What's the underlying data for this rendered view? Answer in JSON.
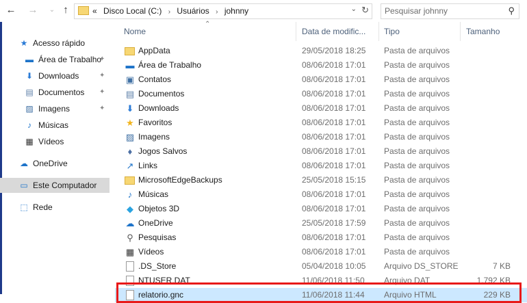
{
  "address": {
    "crumbs": [
      "«",
      "Disco Local (C:)",
      "›",
      "Usuários",
      "›",
      "johnny"
    ],
    "dropdown_icon": "chevron-down-icon",
    "refresh_icon": "refresh-icon"
  },
  "search": {
    "placeholder": "Pesquisar johnny"
  },
  "nav": {
    "items": [
      {
        "label": "Acesso rápido",
        "icon": "star",
        "color": "#2b7bd6",
        "pinned": false
      },
      {
        "label": "Área de Trabalho",
        "icon": "desktop",
        "color": "#1d73c9",
        "pinned": true
      },
      {
        "label": "Downloads",
        "icon": "download",
        "color": "#2b7bd6",
        "pinned": true
      },
      {
        "label": "Documentos",
        "icon": "doc",
        "color": "#5d7fa8",
        "pinned": true
      },
      {
        "label": "Imagens",
        "icon": "pic",
        "color": "#3f6fa3",
        "pinned": true
      },
      {
        "label": "Músicas",
        "icon": "music",
        "color": "#1d73c9",
        "pinned": false
      },
      {
        "label": "Vídeos",
        "icon": "video",
        "color": "#333333",
        "pinned": false
      },
      {
        "label": "OneDrive",
        "icon": "cloud",
        "color": "#1d73c9",
        "pinned": false
      },
      {
        "label": "Este Computador",
        "icon": "pc",
        "color": "#1d73c9",
        "pinned": false,
        "selected": true
      },
      {
        "label": "Rede",
        "icon": "net",
        "color": "#1d73c9",
        "pinned": false
      }
    ]
  },
  "columns": {
    "name": "Nome",
    "date": "Data de modific...",
    "type": "Tipo",
    "size": "Tamanho"
  },
  "files": [
    {
      "name": "AppData",
      "date": "29/05/2018 18:25",
      "type": "Pasta de arquivos",
      "size": "",
      "icon": "folder"
    },
    {
      "name": "Área de Trabalho",
      "date": "08/06/2018 17:01",
      "type": "Pasta de arquivos",
      "size": "",
      "icon": "desktop"
    },
    {
      "name": "Contatos",
      "date": "08/06/2018 17:01",
      "type": "Pasta de arquivos",
      "size": "",
      "icon": "contacts"
    },
    {
      "name": "Documentos",
      "date": "08/06/2018 17:01",
      "type": "Pasta de arquivos",
      "size": "",
      "icon": "doc"
    },
    {
      "name": "Downloads",
      "date": "08/06/2018 17:01",
      "type": "Pasta de arquivos",
      "size": "",
      "icon": "download"
    },
    {
      "name": "Favoritos",
      "date": "08/06/2018 17:01",
      "type": "Pasta de arquivos",
      "size": "",
      "icon": "star"
    },
    {
      "name": "Imagens",
      "date": "08/06/2018 17:01",
      "type": "Pasta de arquivos",
      "size": "",
      "icon": "pic"
    },
    {
      "name": "Jogos Salvos",
      "date": "08/06/2018 17:01",
      "type": "Pasta de arquivos",
      "size": "",
      "icon": "games"
    },
    {
      "name": "Links",
      "date": "08/06/2018 17:01",
      "type": "Pasta de arquivos",
      "size": "",
      "icon": "link"
    },
    {
      "name": "MicrosoftEdgeBackups",
      "date": "25/05/2018 15:15",
      "type": "Pasta de arquivos",
      "size": "",
      "icon": "folder"
    },
    {
      "name": "Músicas",
      "date": "08/06/2018 17:01",
      "type": "Pasta de arquivos",
      "size": "",
      "icon": "music"
    },
    {
      "name": "Objetos 3D",
      "date": "08/06/2018 17:01",
      "type": "Pasta de arquivos",
      "size": "",
      "icon": "cube"
    },
    {
      "name": "OneDrive",
      "date": "25/05/2018 17:59",
      "type": "Pasta de arquivos",
      "size": "",
      "icon": "cloud"
    },
    {
      "name": "Pesquisas",
      "date": "08/06/2018 17:01",
      "type": "Pasta de arquivos",
      "size": "",
      "icon": "search"
    },
    {
      "name": "Vídeos",
      "date": "08/06/2018 17:01",
      "type": "Pasta de arquivos",
      "size": "",
      "icon": "video"
    },
    {
      "name": ".DS_Store",
      "date": "05/04/2018 10:05",
      "type": "Arquivo DS_STORE",
      "size": "7 KB",
      "icon": "file"
    },
    {
      "name": "NTUSER.DAT",
      "date": "11/06/2018 11:50",
      "type": "Arquivo DAT",
      "size": "1.792 KB",
      "icon": "file"
    },
    {
      "name": "relatorio.gnc",
      "date": "11/06/2018 11:44",
      "type": "Arquivo HTML",
      "size": "229 KB",
      "icon": "file",
      "highlighted": true
    }
  ],
  "colors": {
    "accent": "#cce8ff",
    "highlight_box": "#e81919",
    "header_text": "#4c607a"
  }
}
